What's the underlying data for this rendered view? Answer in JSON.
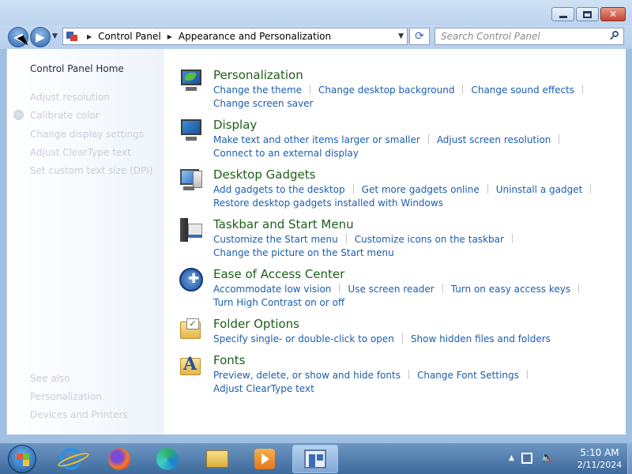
{
  "window": {
    "min_glyph": "–",
    "max_glyph": "□",
    "close_glyph": "✕"
  },
  "nav": {
    "back_glyph": "◀",
    "forward_glyph": "▶",
    "recent_glyph": "▼"
  },
  "address": {
    "crumbs": [
      "Control Panel",
      "Appearance and Personalization"
    ],
    "crumb_separator": "▶",
    "dropdown_glyph": "▼",
    "refresh_glyph": "⟳"
  },
  "search": {
    "placeholder": "Search Control Panel"
  },
  "left_pane": {
    "home": "Control Panel Home",
    "tasks": [
      "Adjust resolution",
      "Calibrate color",
      "Change display settings",
      "Adjust ClearType text",
      "Set custom text size (DPI)"
    ],
    "see_also_title": "See also",
    "see_also": [
      "Personalization",
      "Devices and Printers"
    ]
  },
  "categories": [
    {
      "title": "Personalization",
      "icon": "personalization-icon",
      "links": [
        "Change the theme",
        "Change desktop background",
        "Change sound effects",
        "Change screen saver"
      ]
    },
    {
      "title": "Display",
      "icon": "display-icon",
      "links": [
        "Make text and other items larger or smaller",
        "Adjust screen resolution",
        "Connect to an external display"
      ]
    },
    {
      "title": "Desktop Gadgets",
      "icon": "desktop-gadgets-icon",
      "links": [
        "Add gadgets to the desktop",
        "Get more gadgets online",
        "Uninstall a gadget",
        "Restore desktop gadgets installed with Windows"
      ]
    },
    {
      "title": "Taskbar and Start Menu",
      "icon": "taskbar-start-menu-icon",
      "links": [
        "Customize the Start menu",
        "Customize icons on the taskbar",
        "Change the picture on the Start menu"
      ]
    },
    {
      "title": "Ease of Access Center",
      "icon": "ease-of-access-icon",
      "links": [
        "Accommodate low vision",
        "Use screen reader",
        "Turn on easy access keys",
        "Turn High Contrast on or off"
      ]
    },
    {
      "title": "Folder Options",
      "icon": "folder-options-icon",
      "links": [
        "Specify single- or double-click to open",
        "Show hidden files and folders"
      ]
    },
    {
      "title": "Fonts",
      "icon": "fonts-icon",
      "links": [
        "Preview, delete, or show and hide fonts",
        "Change Font Settings",
        "Adjust ClearType text"
      ]
    }
  ],
  "taskbar": {
    "apps": [
      {
        "name": "internet-explorer-icon"
      },
      {
        "name": "firefox-icon"
      },
      {
        "name": "edge-icon"
      },
      {
        "name": "windows-explorer-icon"
      },
      {
        "name": "media-player-icon"
      },
      {
        "name": "control-panel-icon",
        "active": true
      }
    ],
    "clock": {
      "time": "5:10 AM",
      "date": "2/11/2024"
    },
    "tray_up_glyph": "▲",
    "volume_glyph": "🔈",
    "mute_glyph": "✕"
  },
  "colors": {
    "link": "#1a5eb0",
    "category_title": "#1e5e19",
    "disabled_text": "#c6ced8"
  }
}
